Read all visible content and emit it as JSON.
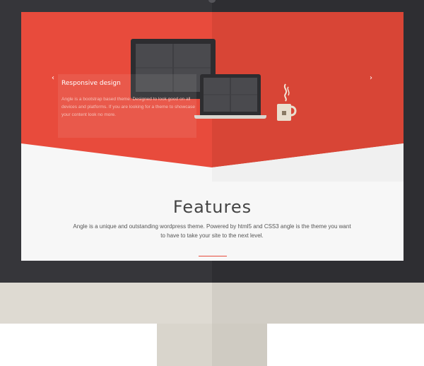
{
  "slider": {
    "title": "Responsive design",
    "body": "Angle is a bootstrap based theme. Designed to look good on all devices and platforms. If you are looking for a theme to showcase your content look no more.",
    "prev_label": "‹",
    "next_label": "›"
  },
  "features": {
    "title": "Features",
    "description": "Angle is a unique and outstanding wordpress theme. Powered by html5 and CSS3 angle is the theme you want to have to take your site to the next level."
  },
  "colors": {
    "accent": "#e84b3c",
    "bezel": "#36363a",
    "chin": "#dedad2"
  },
  "icons": [
    "imac-illustration",
    "laptop-illustration",
    "mug-illustration",
    "chevron-left-icon",
    "chevron-right-icon"
  ]
}
